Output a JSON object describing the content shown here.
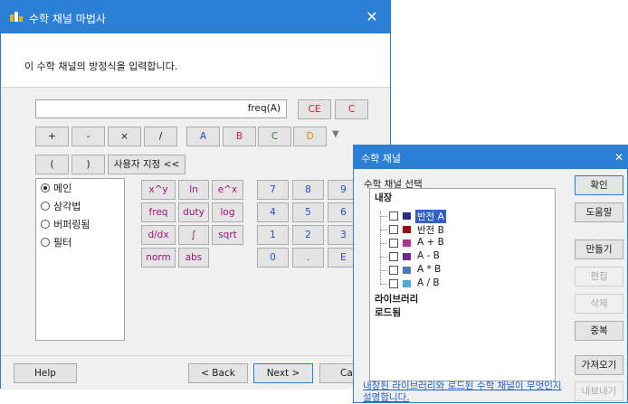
{
  "wizard": {
    "title": "수학 채널 마법사",
    "instruction": "이 수학 채널의 방정식을 입력합니다.",
    "expression_value": "freq(A)",
    "buttons": {
      "ce": "CE",
      "c": "C",
      "plus": "+",
      "minus": "-",
      "times": "×",
      "divide": "/",
      "a": "A",
      "b": "B",
      "c_ch": "C",
      "d": "D",
      "lparen": "(",
      "rparen": ")",
      "custom": "사용자 지정 <<",
      "xpow": "x^y",
      "ln": "ln",
      "epow": "e^x",
      "freq": "freq",
      "duty": "duty",
      "log": "log",
      "ddx": "d/dx",
      "integral": "∫",
      "sqrt": "sqrt",
      "norm": "norm",
      "abs": "abs",
      "n7": "7",
      "n8": "8",
      "n9": "9",
      "n4": "4",
      "n5": "5",
      "n6": "6",
      "n1": "1",
      "n2": "2",
      "n3": "3",
      "n0": "0",
      "dot": ".",
      "e": "E"
    },
    "radio_options": [
      "메인",
      "삼각법",
      "버퍼링됨",
      "필터"
    ],
    "radio_selected_index": 0,
    "footer": {
      "help": "Help",
      "back": "< Back",
      "next": "Next >",
      "cancel": "Ca"
    }
  },
  "dialog": {
    "title": "수학 채널",
    "group_label": "수학 채널 선택",
    "tree": {
      "builtin": "내장",
      "items": [
        {
          "label": "반전 A",
          "color": "#2a2a8a",
          "selected": true
        },
        {
          "label": "반전 B",
          "color": "#9a1010",
          "selected": false
        },
        {
          "label": "A + B",
          "color": "#b03090",
          "selected": false
        },
        {
          "label": "A - B",
          "color": "#6a2a9a",
          "selected": false
        },
        {
          "label": "A * B",
          "color": "#4a78c0",
          "selected": false
        },
        {
          "label": "A / B",
          "color": "#50a8d8",
          "selected": false
        }
      ],
      "library": "라이브러리",
      "loaded": "로드됨"
    },
    "buttons": {
      "ok": "확인",
      "help": "도움말",
      "create": "만들기",
      "edit": "편집",
      "delete": "삭제",
      "duplicate": "중복",
      "import": "가져오기",
      "export": "내보내기"
    },
    "link_text": "내장된 라이브러리와 로드된 수학 채널이 무엇인지 설명합니다."
  }
}
